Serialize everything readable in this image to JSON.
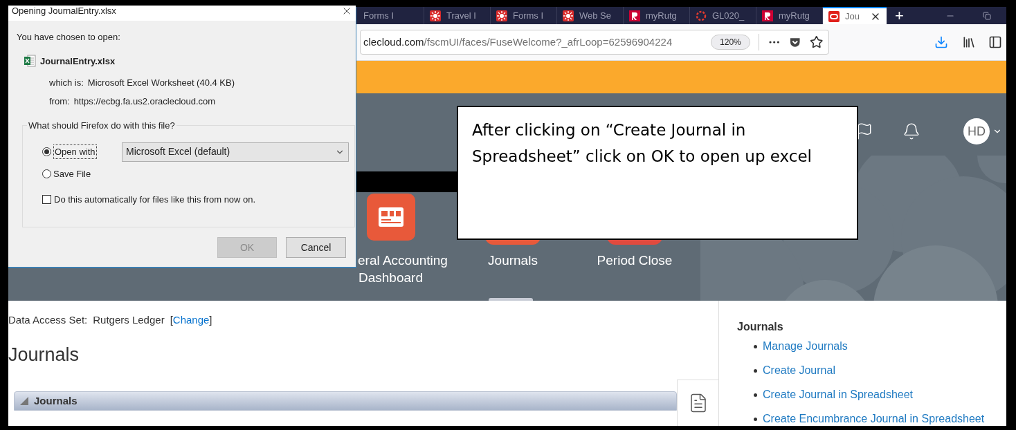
{
  "browser": {
    "tabs": [
      {
        "label": "Forms I",
        "kind": "none",
        "selected": false
      },
      {
        "label": "Travel I",
        "kind": "sun",
        "selected": false
      },
      {
        "label": "Forms I",
        "kind": "sun",
        "selected": false
      },
      {
        "label": "Web Se",
        "kind": "sun",
        "selected": false
      },
      {
        "label": "myRutg",
        "kind": "r-logo",
        "selected": false
      },
      {
        "label": "GL020_",
        "kind": "ring",
        "selected": false
      },
      {
        "label": "myRutg",
        "kind": "r-logo",
        "selected": false
      },
      {
        "label": "Jou",
        "kind": "oracle",
        "selected": true
      }
    ],
    "new_tab": "+",
    "url_host": "clecloud.com",
    "url_path": "/fscmUI/faces/FuseWelcome?_afrLoop=62596904224",
    "zoom": "120%"
  },
  "banner": {
    "avatar": "HD",
    "apps": [
      {
        "lines": [
          "eral Accounting",
          "Dashboard"
        ],
        "color": "#e8593a"
      },
      {
        "lines": [
          "Journals"
        ],
        "color": "#e8593a"
      },
      {
        "lines": [
          "Period Close"
        ],
        "color": "#e14a3e"
      }
    ]
  },
  "page": {
    "access_label": "Data Access Set:",
    "access_value": "Rutgers Ledger",
    "bracket_open": "[",
    "change_link": "Change",
    "bracket_close": "]",
    "title": "Journals",
    "panel_title": "Journals"
  },
  "tasks": {
    "heading": "Journals",
    "links": [
      "Manage Journals",
      "Create Journal",
      "Create Journal in Spreadsheet",
      "Create Encumbrance Journal in Spreadsheet"
    ]
  },
  "dialog": {
    "title": "Opening JournalEntry.xlsx",
    "intro": "You have chosen to open:",
    "file_name": "JournalEntry.xlsx",
    "type_label": "which is:",
    "type_value": "Microsoft Excel Worksheet (40.4 KB)",
    "from_label": "from:",
    "from_value": "https://ecbg.fa.us2.oraclecloud.com",
    "group_label": "What should Firefox do with this file?",
    "options": [
      {
        "label": "Open with",
        "selected": true
      },
      {
        "label": "Save File",
        "selected": false
      }
    ],
    "app_select": "Microsoft Excel (default)",
    "auto_checkbox": {
      "label": "Do this automatically for files like this from now on.",
      "checked": false
    },
    "buttons": [
      {
        "label": "OK",
        "disabled": true
      },
      {
        "label": "Cancel",
        "disabled": false
      }
    ]
  },
  "callout": {
    "text": "After clicking on “Create Journal in Spreadsheet” click on OK to open up excel"
  }
}
